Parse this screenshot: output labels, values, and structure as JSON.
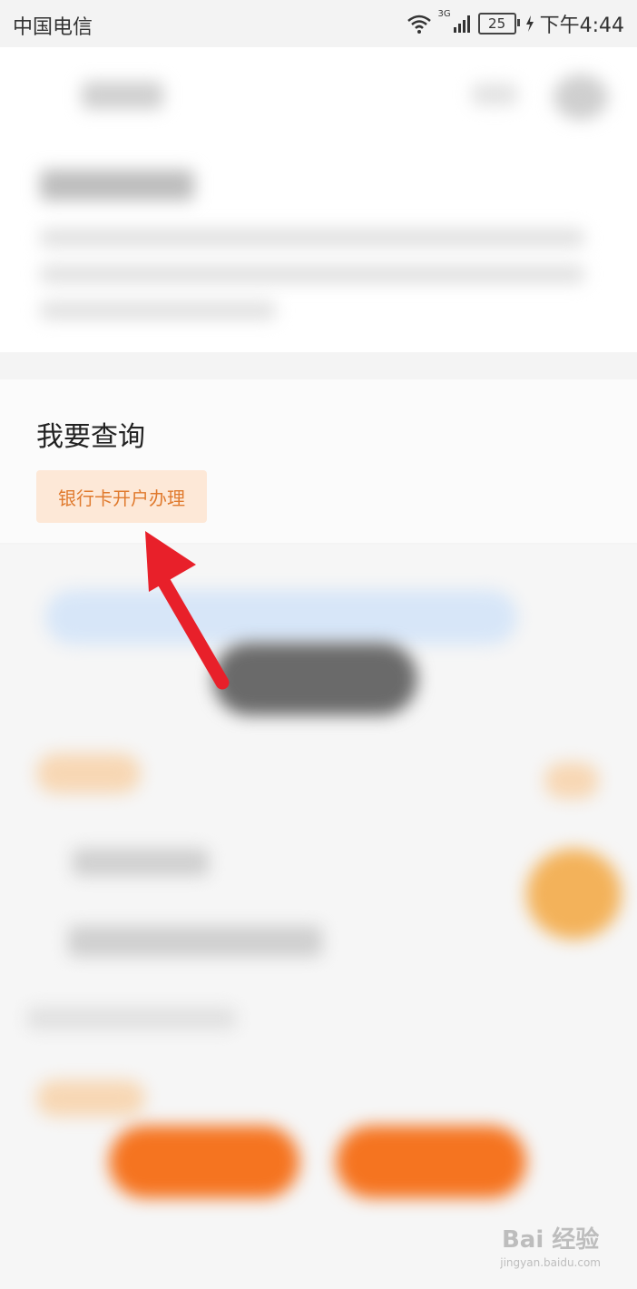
{
  "status_bar": {
    "carrier": "中国电信",
    "network": "3G",
    "battery": "25",
    "time": "下午4:44"
  },
  "query_section": {
    "title": "我要查询",
    "chip_label": "银行卡开户办理"
  },
  "annotation": {
    "arrow_color": "#e8202a"
  },
  "watermark": {
    "brand": "Bai 经验",
    "url": "jingyan.baidu.com"
  },
  "colors": {
    "chip_bg": "#fde8d7",
    "chip_text": "#e07a2e",
    "accent_orange": "#f57420"
  }
}
